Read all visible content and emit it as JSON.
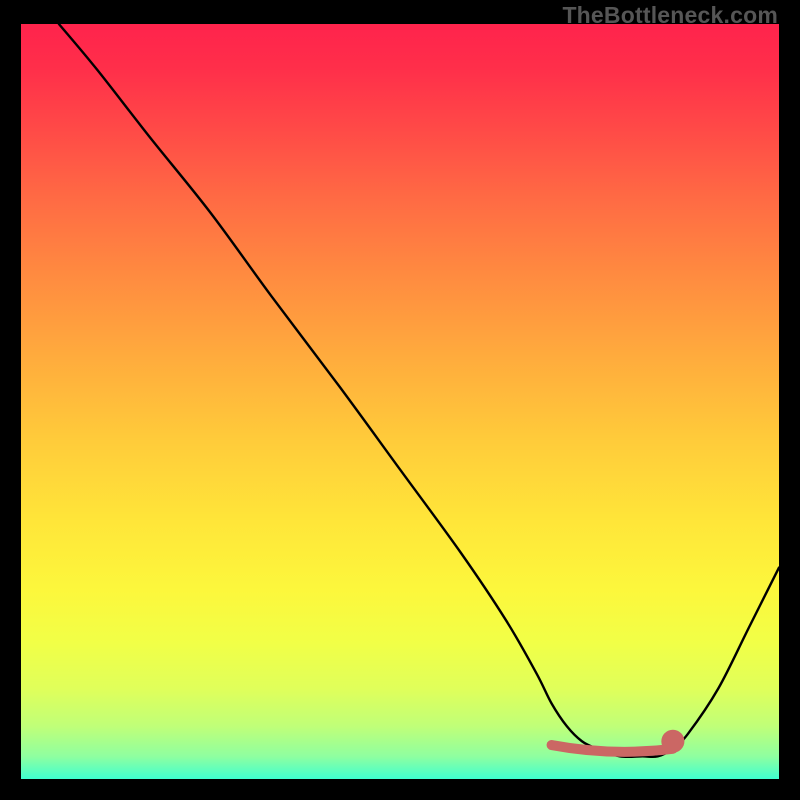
{
  "watermark": "TheBottleneck.com",
  "chart_data": {
    "type": "line",
    "title": "",
    "xlabel": "",
    "ylabel": "",
    "xlim": [
      0,
      100
    ],
    "ylim": [
      0,
      100
    ],
    "grid": false,
    "legend": false,
    "series": [
      {
        "name": "curve",
        "color": "#000000",
        "x": [
          5,
          10,
          17,
          25,
          33,
          42,
          50,
          58,
          64,
          68,
          70,
          72,
          74,
          76,
          79,
          82,
          84,
          86,
          88,
          92,
          96,
          100
        ],
        "y": [
          100,
          94,
          85,
          75,
          64,
          52,
          41,
          30,
          21,
          14,
          10,
          7,
          5,
          4,
          3,
          3,
          3,
          4,
          6,
          12,
          20,
          28
        ]
      }
    ],
    "marker_band": {
      "color": "#cb6764",
      "x_start": 70,
      "x_end": 86,
      "y": 3,
      "end_dot": {
        "x": 86,
        "y": 5,
        "r": 1.0
      }
    }
  }
}
